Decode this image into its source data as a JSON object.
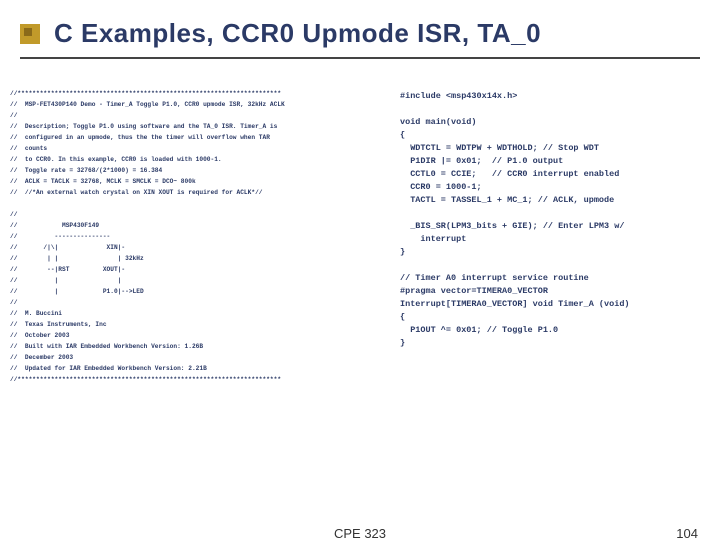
{
  "title": "C Examples, CCR0 Upmode ISR, TA_0",
  "left_code": "//***********************************************************************\n//  MSP-FET430P140 Demo - Timer_A Toggle P1.0, CCR0 upmode ISR, 32kHz ACLK\n//\n//  Description; Toggle P1.0 using software and the TA_0 ISR. Timer_A is\n//  configured in an upmode, thus the the timer will overflow when TAR\n//  counts\n//  to CCR0. In this example, CCR0 is loaded with 1000-1.\n//  Toggle rate = 32768/(2*1000) = 16.384\n//  ACLK = TACLK = 32768, MCLK = SMCLK = DCO~ 800k\n//  //*An external watch crystal on XIN XOUT is required for ACLK*//\n\n//\n//            MSP430F149\n//          ---------------\n//       /|\\|             XIN|-\n//        | |                | 32kHz\n//        --|RST         XOUT|-\n//          |                |\n//          |            P1.0|-->LED\n//\n//  M. Buccini\n//  Texas Instruments, Inc\n//  October 2003\n//  Built with IAR Embedded Workbench Version: 1.26B\n//  December 2003\n//  Updated for IAR Embedded Workbench Version: 2.21B\n//***********************************************************************",
  "right_code": "#include <msp430x14x.h>\n\nvoid main(void)\n{\n  WDTCTL = WDTPW + WDTHOLD; // Stop WDT\n  P1DIR |= 0x01;  // P1.0 output\n  CCTL0 = CCIE;   // CCR0 interrupt enabled\n  CCR0 = 1000-1;\n  TACTL = TASSEL_1 + MC_1; // ACLK, upmode\n\n  _BIS_SR(LPM3_bits + GIE); // Enter LPM3 w/\n    interrupt\n}\n\n// Timer A0 interrupt service routine\n#pragma vector=TIMERA0_VECTOR\nInterrupt[TIMERA0_VECTOR] void Timer_A (void)\n{\n  P1OUT ^= 0x01; // Toggle P1.0\n}",
  "footer_center": "CPE 323",
  "footer_right": "104"
}
